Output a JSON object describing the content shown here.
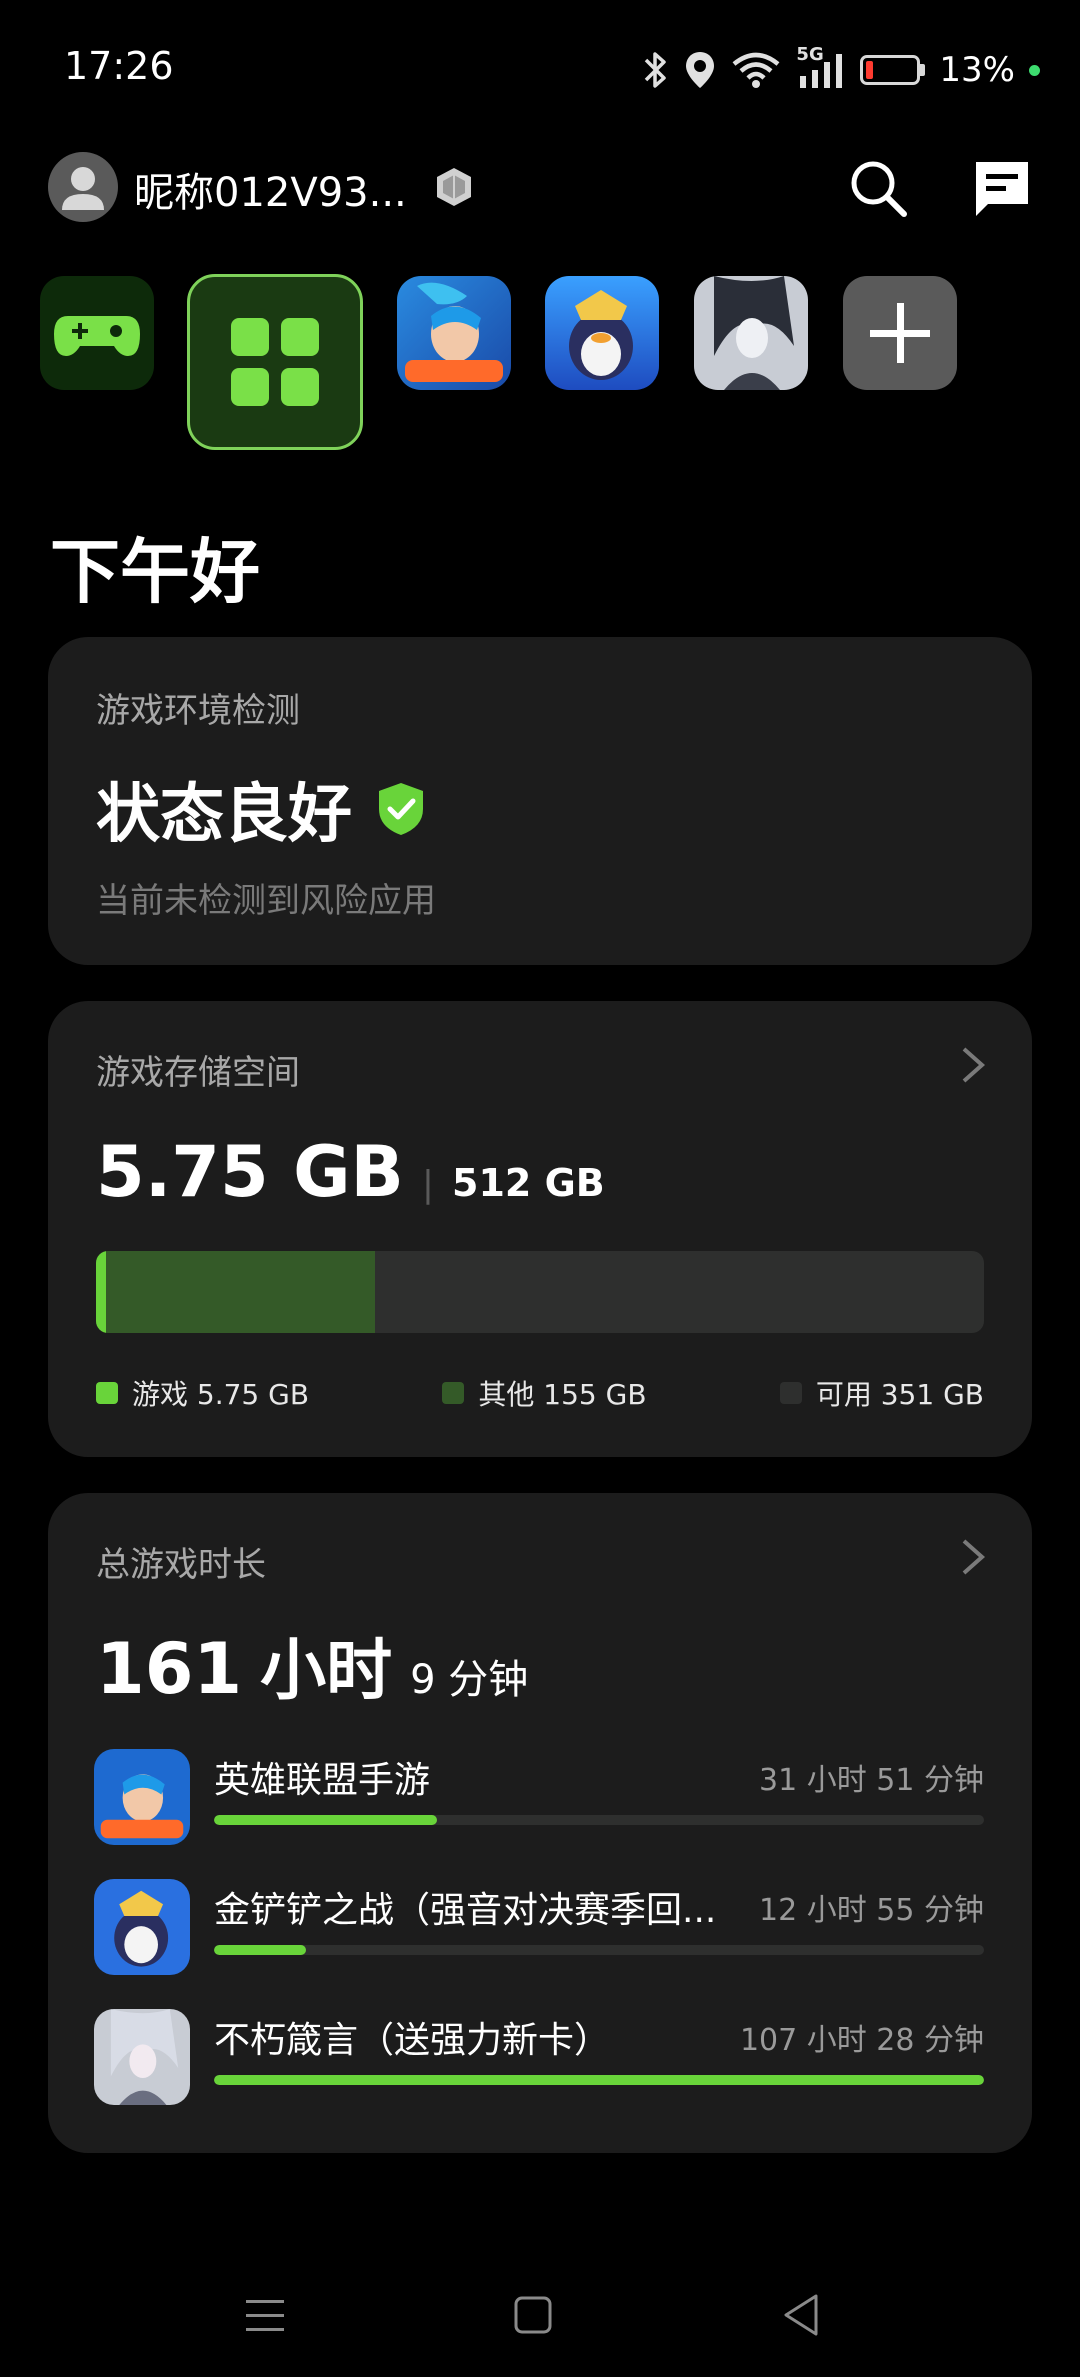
{
  "status_bar": {
    "time": "17:26",
    "network": "5G",
    "battery_percent": "13%",
    "battery_level": 0.13
  },
  "header": {
    "nickname": "昵称012V93...",
    "icons": [
      "avatar-icon",
      "hexagon-badge-icon",
      "search-icon",
      "message-icon"
    ]
  },
  "game_row": {
    "items": [
      "controller-icon",
      "grid-icon",
      "league-of-legends-game",
      "tft-game",
      "immortal-game",
      "add-icon"
    ]
  },
  "greeting": "下午好",
  "env_card": {
    "title": "游戏环境检测",
    "status": "状态良好",
    "subtitle": "当前未检测到风险应用"
  },
  "storage_card": {
    "title": "游戏存储空间",
    "used": "5.75 GB",
    "separator": "|",
    "total": "512 GB",
    "games_fraction": 0.011,
    "other_fraction": 0.303,
    "legend": [
      {
        "label": "游戏 5.75 GB",
        "color": "#69d43a"
      },
      {
        "label": "其他 155 GB",
        "color": "#345a28"
      },
      {
        "label": "可用 351 GB",
        "color": "#2e2f2e"
      }
    ]
  },
  "playtime_card": {
    "title": "总游戏时长",
    "hours_num": "161",
    "hours_unit": "小时",
    "minutes": "9 分钟",
    "games": [
      {
        "name": "英雄联盟手游",
        "time": "31 小时 51 分钟",
        "fraction": 0.29
      },
      {
        "name": "金铲铲之战（强音对决赛季回...",
        "time": "12 小时 55 分钟",
        "fraction": 0.12
      },
      {
        "name": "不朽箴言（送强力新卡）",
        "time": "107 小时 28 分钟",
        "fraction": 1.0
      }
    ]
  },
  "colors": {
    "accent": "#69d43a",
    "card_bg": "#1c1c1c",
    "background": "#000000"
  }
}
